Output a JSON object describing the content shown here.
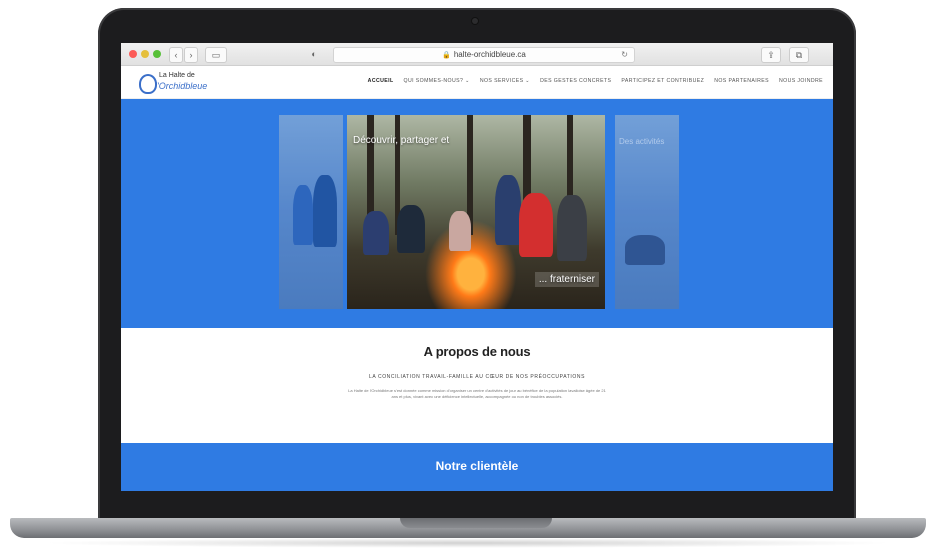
{
  "browser": {
    "url": "halte-orchidbleue.ca",
    "back_icon": "‹",
    "forward_icon": "›",
    "sidebar_icon": "▭",
    "shield_icon": "◐",
    "reload_icon": "↻",
    "share_icon": "⇪",
    "tabs_icon": "⧉"
  },
  "site": {
    "logo_top": "La Halte de",
    "logo_bottom": "l'Orchidbleue",
    "nav": [
      {
        "label": "ACCUEIL"
      },
      {
        "label": "QUI SOMMES-NOUS? ⌄"
      },
      {
        "label": "NOS SERVICES ⌄"
      },
      {
        "label": "DES GESTES CONCRETS"
      },
      {
        "label": "PARTICIPEZ ET CONTRIBUEZ"
      },
      {
        "label": "NOS PARTENAIRES"
      },
      {
        "label": "NOUS JOINDRE"
      }
    ]
  },
  "hero": {
    "caption_top": "Découvrir, partager et",
    "caption_bottom": "... fraterniser",
    "side_right_caption": "Des activités"
  },
  "about": {
    "title": "A propos de nous",
    "subtitle": "LA CONCILIATION TRAVAIL-FAMILLE AU CŒUR DE NOS PRÉOCCUPATIONS",
    "body": "La Halte de l'Orchidbleue s'est donnée comme mission d'organiser un centre d'activités de jour au bénéfice de la population lavalloise âgée de 21 ans et plus, vivant avec une déficience intellectuelle, accompagnée ou non de troubles associés."
  },
  "clientele": {
    "title": "Notre clientèle"
  },
  "colors": {
    "brand_blue": "#2f7be3",
    "logo_blue": "#3b6fc9"
  }
}
